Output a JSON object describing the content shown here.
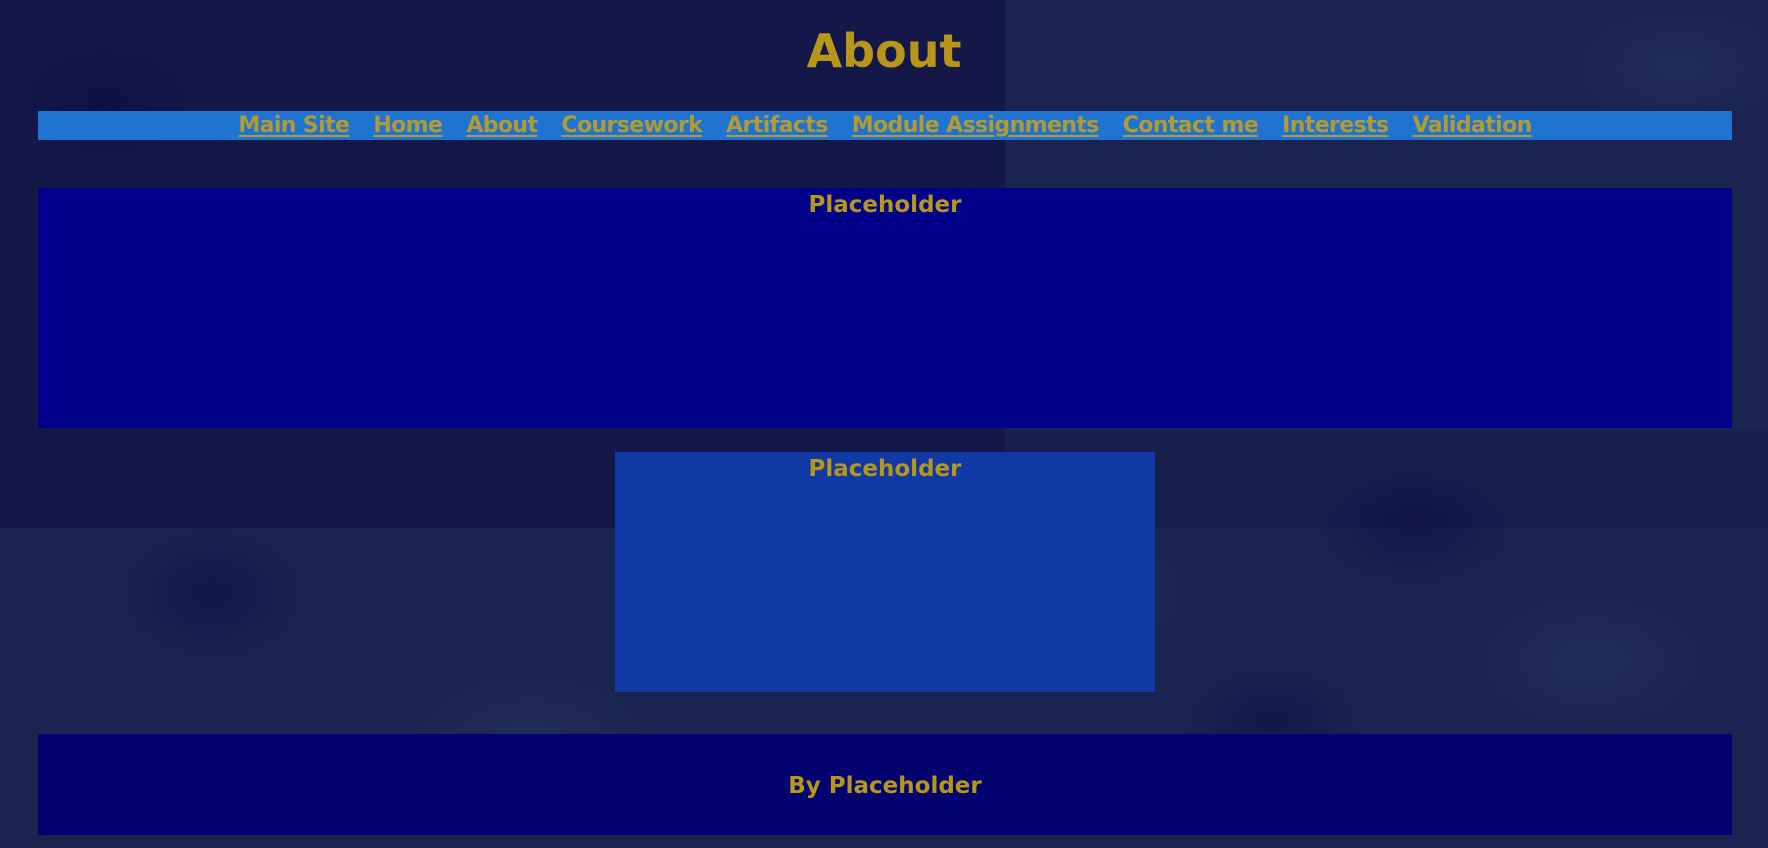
{
  "header": {
    "title": "About"
  },
  "nav": {
    "items": [
      {
        "label": "Main Site"
      },
      {
        "label": "Home"
      },
      {
        "label": "About"
      },
      {
        "label": "Coursework"
      },
      {
        "label": "Artifacts"
      },
      {
        "label": "Module Assignments"
      },
      {
        "label": "Contact me"
      },
      {
        "label": "Interests"
      },
      {
        "label": "Validation"
      }
    ]
  },
  "sections": {
    "top": {
      "heading": "Placeholder"
    },
    "middle": {
      "heading": "Placeholder"
    }
  },
  "footer": {
    "text": "By Placeholder"
  },
  "colors": {
    "text_gold": "#b8961a",
    "nav_bar": "#1e74d0",
    "section_top": "#000088",
    "section_middle": "#0f3aa6",
    "footer": "#02036e",
    "background": "#1a2450"
  }
}
